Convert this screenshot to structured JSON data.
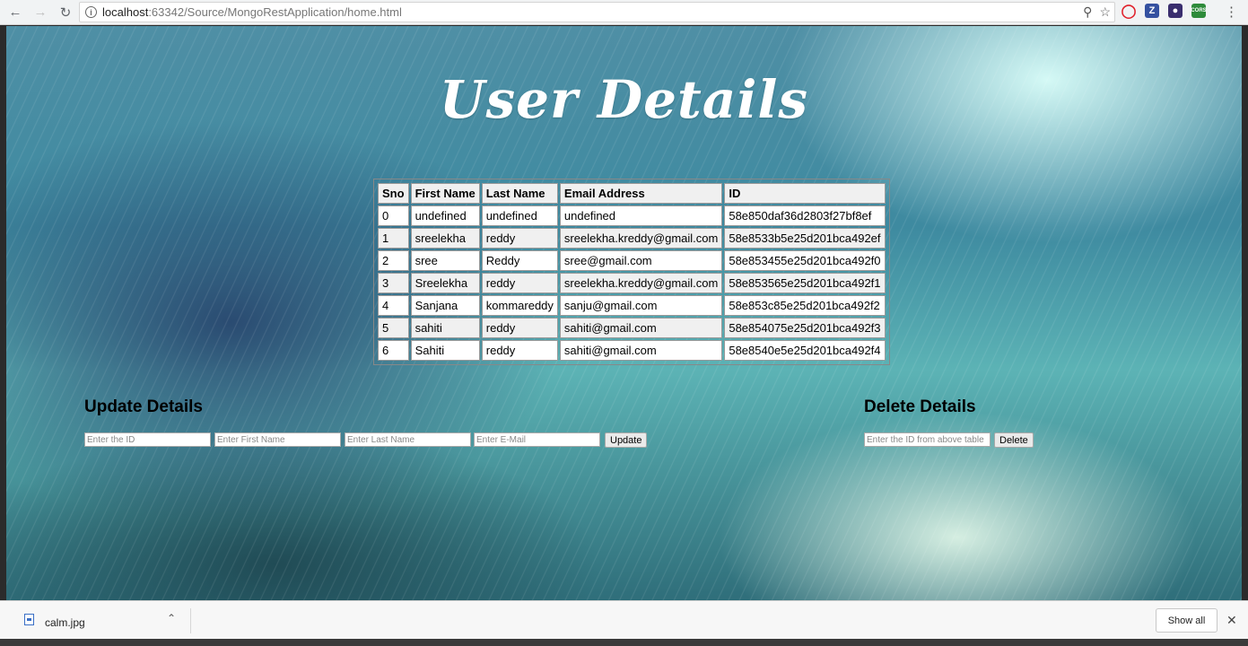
{
  "browser": {
    "url_host": "localhost",
    "url_path": ":63342/Source/MongoRestApplication/home.html"
  },
  "page": {
    "title": "User Details",
    "table": {
      "headers": [
        "Sno",
        "First Name",
        "Last Name",
        "Email Address",
        "ID"
      ],
      "rows": [
        [
          "0",
          "undefined",
          "undefined",
          "undefined",
          "58e850daf36d2803f27bf8ef"
        ],
        [
          "1",
          "sreelekha",
          "reddy",
          "sreelekha.kreddy@gmail.com",
          "58e8533b5e25d201bca492ef"
        ],
        [
          "2",
          "sree",
          "Reddy",
          "sree@gmail.com",
          "58e853455e25d201bca492f0"
        ],
        [
          "3",
          "Sreelekha",
          "reddy",
          "sreelekha.kreddy@gmail.com",
          "58e853565e25d201bca492f1"
        ],
        [
          "4",
          "Sanjana",
          "kommareddy",
          "sanju@gmail.com",
          "58e853c85e25d201bca492f2"
        ],
        [
          "5",
          "sahiti",
          "reddy",
          "sahiti@gmail.com",
          "58e854075e25d201bca492f3"
        ],
        [
          "6",
          "Sahiti",
          "reddy",
          "sahiti@gmail.com",
          "58e8540e5e25d201bca492f4"
        ]
      ]
    },
    "update": {
      "title": "Update Details",
      "id_placeholder": "Enter the ID",
      "first_placeholder": "Enter First Name",
      "last_placeholder": "Enter Last Name",
      "email_placeholder": "Enter E-Mail",
      "button_label": "Update"
    },
    "delete": {
      "title": "Delete Details",
      "id_placeholder": "Enter the ID from above table",
      "button_label": "Delete"
    }
  },
  "downloads": {
    "file_name": "calm.jpg",
    "show_all_label": "Show all"
  },
  "icons": {
    "back": "arrow-left",
    "forward": "arrow-right",
    "reload": "reload",
    "info": "info",
    "zoom": "magnifier",
    "bookmark": "star",
    "menu": "vertical-dots",
    "close": "x"
  }
}
